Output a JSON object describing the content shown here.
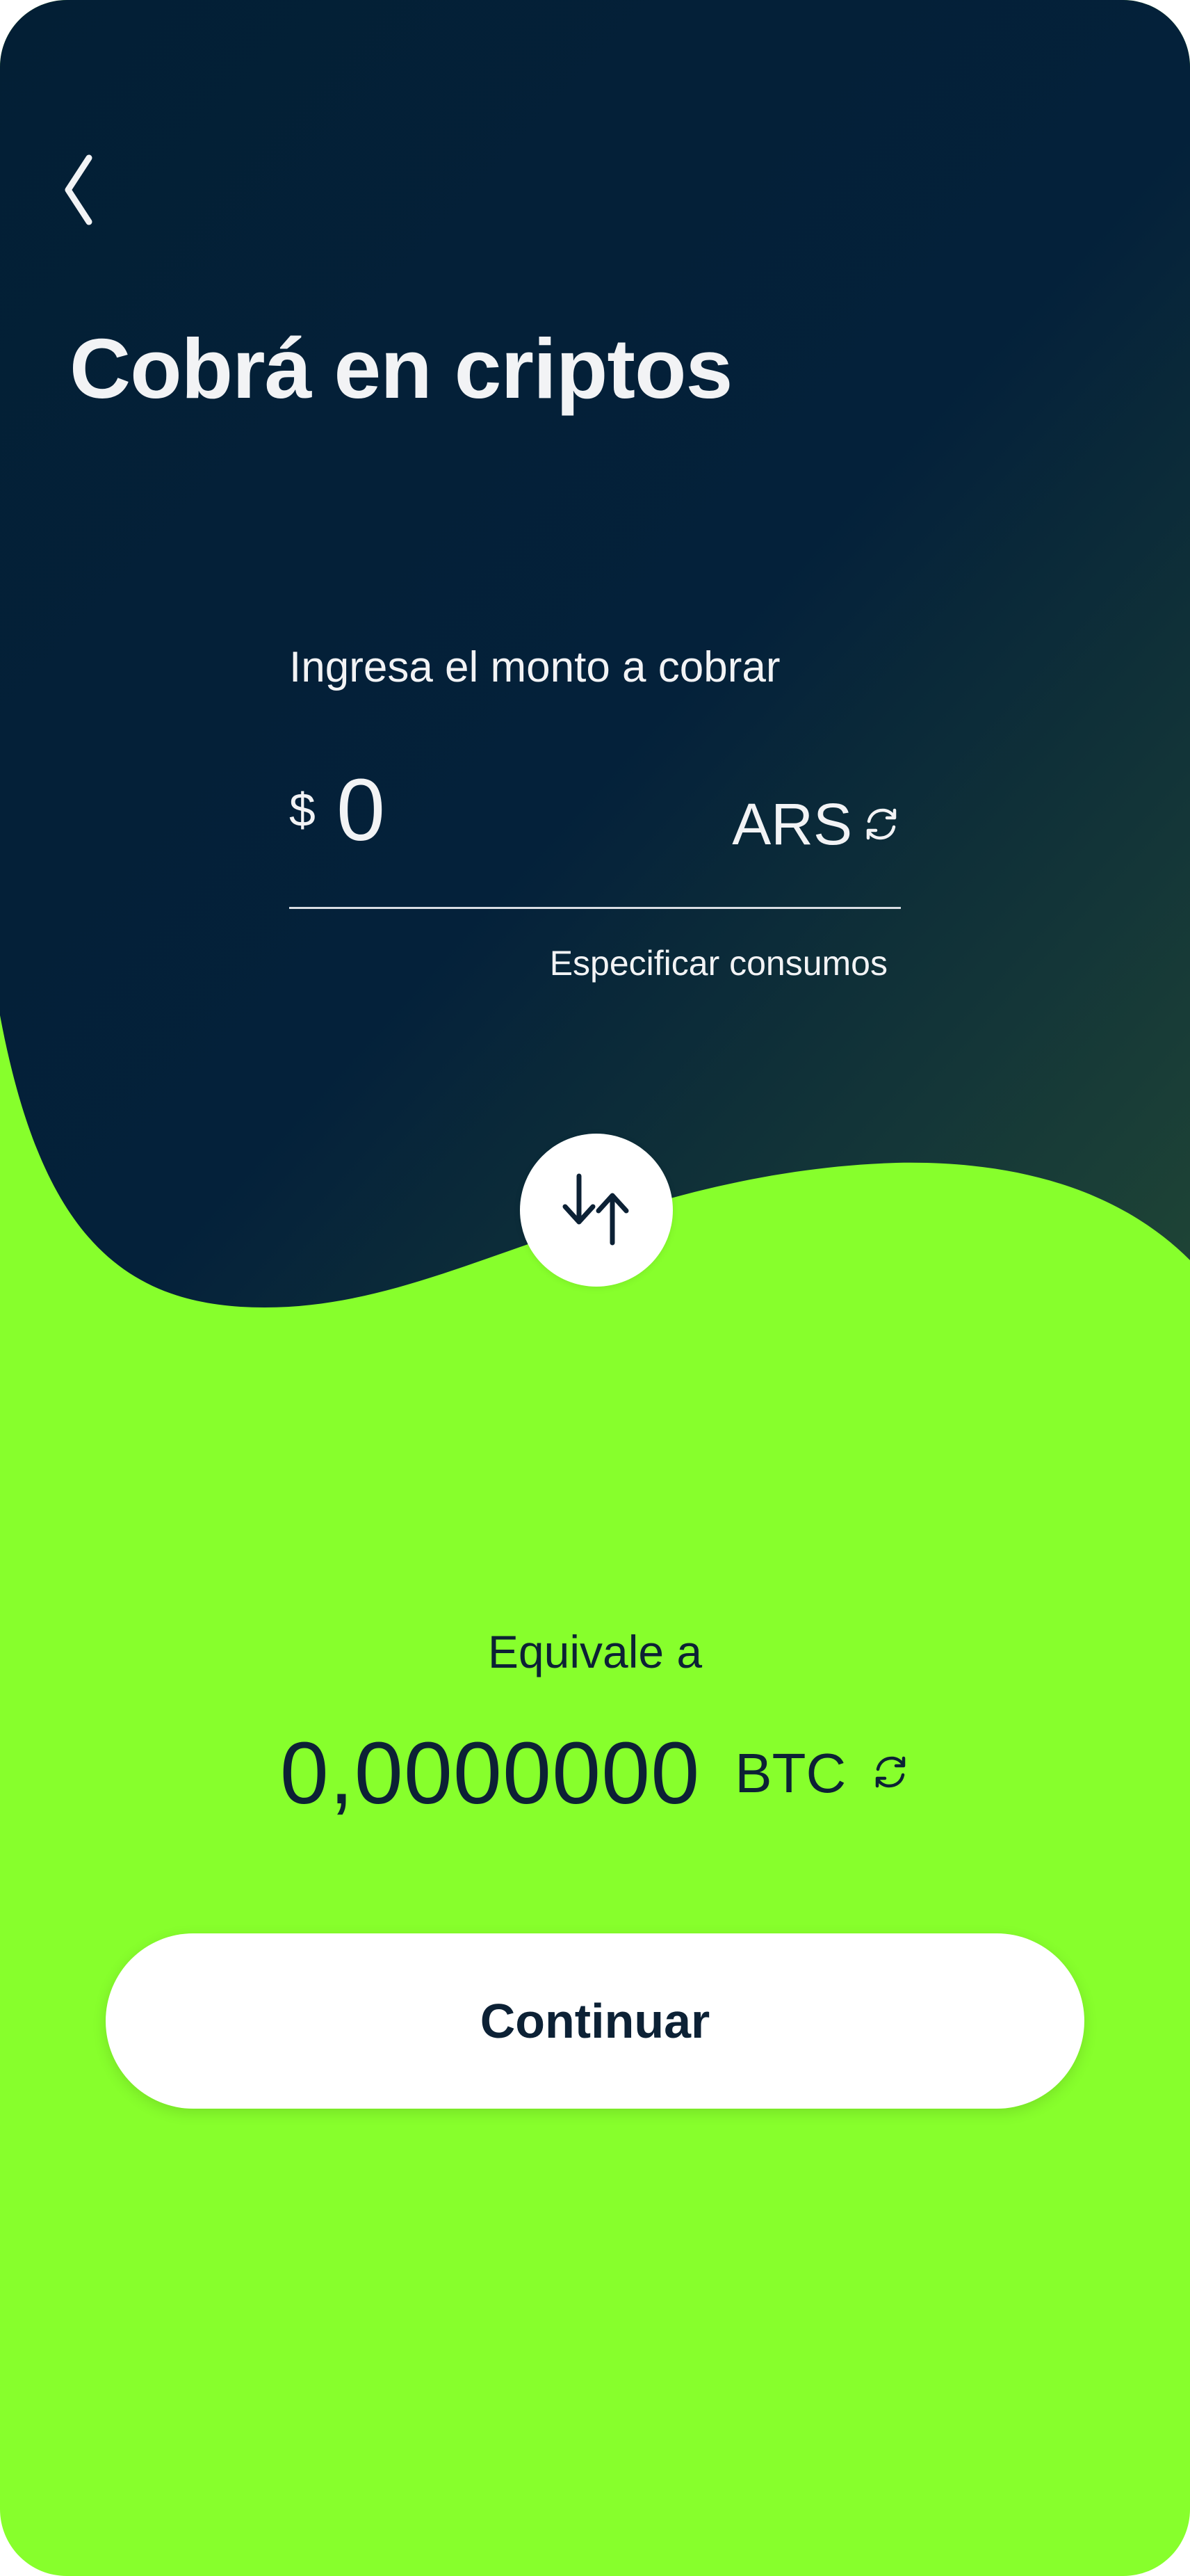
{
  "header": {
    "back_icon": "chevron-left-icon",
    "title": "Cobrá en criptos"
  },
  "amount": {
    "label": "Ingresa el monto a cobrar",
    "currency_symbol": "$",
    "value": "0",
    "placeholder": "0",
    "currency": "ARS",
    "switch_icon": "refresh-icon",
    "specify_link": "Especificar consumos"
  },
  "swap": {
    "icon": "swap-vertical-icon"
  },
  "conversion": {
    "label": "Equivale a",
    "value": "0,0000000",
    "currency": "BTC",
    "switch_icon": "refresh-icon"
  },
  "actions": {
    "continue_label": "Continuar"
  },
  "colors": {
    "header_dark": "#031f35",
    "header_gradient_end": "#163a33",
    "accent_green": "#87ff2c",
    "text_light": "#f2f3f5",
    "text_dark": "#0c2135",
    "button_bg": "#ffffff"
  }
}
